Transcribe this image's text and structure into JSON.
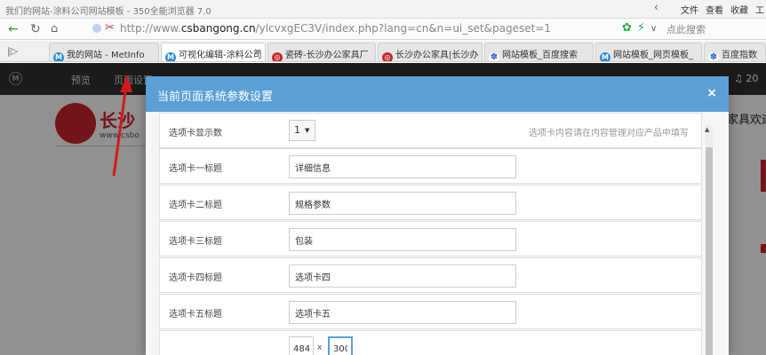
{
  "window": {
    "title": "我们的网站-涂料公司网站模板 - 350全能浏览器 7.0",
    "menu": [
      "文件",
      "查看",
      "收藏",
      "工"
    ]
  },
  "address_bar": {
    "url_prefix": "http://www.",
    "url_host": "csbangong.cn",
    "url_path": "/ylcvxgEC3V/index.php?lang=cn&n=ui_set&pageset=1",
    "search_placeholder": "点此搜索"
  },
  "tabs": [
    {
      "label": "我的网站 - MetInfo",
      "icon": "metinfo-icon",
      "active": false
    },
    {
      "label": "可视化编辑-涂料公司",
      "icon": "metinfo-icon",
      "active": true
    },
    {
      "label": "瓷砖-长沙办公家具厂",
      "icon": "site-icon",
      "active": false
    },
    {
      "label": "长沙办公家具|长沙办",
      "icon": "site-icon",
      "active": false
    },
    {
      "label": "网站模板_百度搜索",
      "icon": "baidu-icon",
      "active": false
    },
    {
      "label": "网站模板_网页模板_",
      "icon": "metinfo-icon",
      "active": false
    },
    {
      "label": "百度指数",
      "icon": "baidu-icon",
      "active": false
    }
  ],
  "cms_nav": {
    "logo": "M",
    "items": [
      "预览",
      "页面设置"
    ],
    "notifications": "20"
  },
  "site": {
    "name": "长沙",
    "domain": "www.csbo",
    "right_text": "家具欢迎"
  },
  "modal": {
    "title": "当前页面系统参数设置",
    "close_label": "×",
    "rows": [
      {
        "label": "选项卡显示数",
        "type": "select",
        "value": "1",
        "hint": "选项卡内容请在内容管理对应产品中填写"
      },
      {
        "label": "选项卡一标题",
        "type": "text",
        "value": "详细信息"
      },
      {
        "label": "选项卡二标题",
        "type": "text",
        "value": "规格参数"
      },
      {
        "label": "选项卡三标题",
        "type": "text",
        "value": "包装"
      },
      {
        "label": "选项卡四标题",
        "type": "text",
        "value": "选项卡四"
      },
      {
        "label": "选项卡五标题",
        "type": "text",
        "value": "选项卡五"
      }
    ],
    "size_row": {
      "width": "484",
      "separator": "x",
      "height": "300"
    }
  },
  "colors": {
    "modal_header": "#5b9fd6",
    "cms_topbar": "#2f2f2f",
    "brand_red": "#c9232a",
    "annotation_arrow": "#d21a1a"
  }
}
